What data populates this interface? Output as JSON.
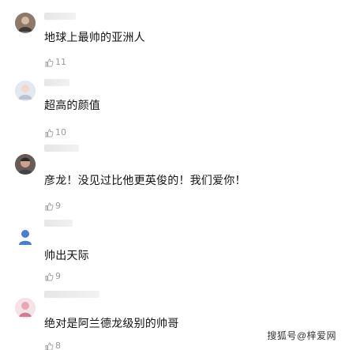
{
  "comments": [
    {
      "text": "地球上最帅的亚洲人",
      "likes": "11",
      "avatar_icon": "user-photo-icon"
    },
    {
      "text": "超高的颜值",
      "likes": "10",
      "avatar_icon": "user-photo-icon"
    },
    {
      "text": "彦龙！没见过比他更英俊的！我们爱你！",
      "likes": "9",
      "avatar_icon": "user-photo-icon"
    },
    {
      "text": "帅出天际",
      "likes": "9",
      "avatar_icon": "default-user-icon"
    },
    {
      "text": "绝对是阿兰德龙级别的帅哥",
      "likes": "8",
      "avatar_icon": "user-photo-icon"
    }
  ],
  "colors": {
    "accent": "#4a7fd0",
    "like_gray": "#9a9a9a"
  },
  "watermark": "搜狐号@梓爱网"
}
